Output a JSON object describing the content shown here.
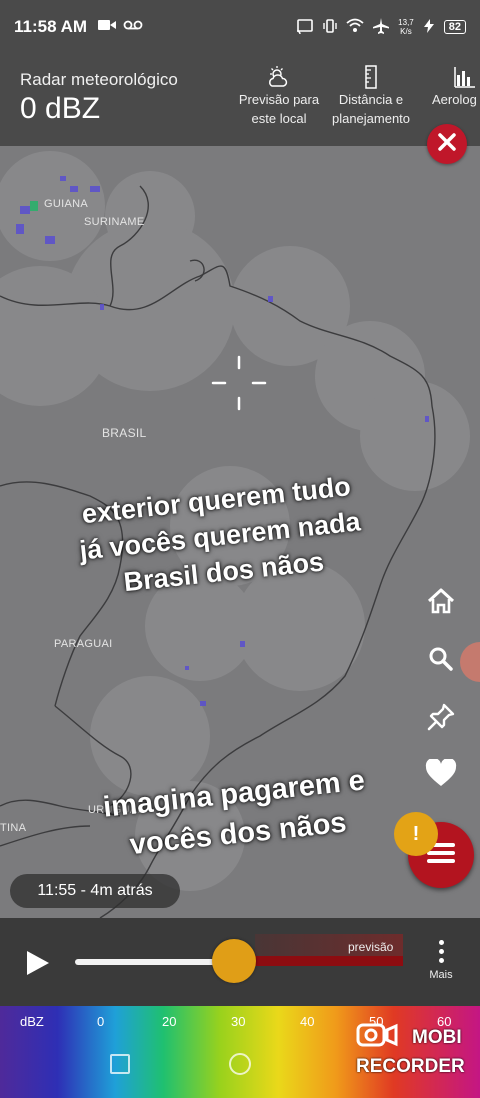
{
  "status": {
    "time": "11:58 AM",
    "net_speed_value": "13,7",
    "net_speed_unit": "K/s",
    "battery": "82"
  },
  "header": {
    "title": "Radar meteorológico",
    "value": "0 dBZ",
    "tools": [
      {
        "line1": "Previsão para",
        "line2": "este local",
        "icon": "sun-cloud-icon"
      },
      {
        "line1": "Distância e",
        "line2": "planejamento",
        "icon": "ruler-icon"
      },
      {
        "line1": "Aerolog",
        "line2": "",
        "icon": "bar-chart-icon"
      }
    ]
  },
  "map": {
    "labels": {
      "guiana": "GUIANA",
      "suriname": "SURINAME",
      "brasil": "BRASIL",
      "paraguai": "PARAGUAI",
      "uruguai": "URUGUAI",
      "argentina": "TINA"
    },
    "overlay_text_1": [
      "exterior querem tudo",
      "já vocês querem nada",
      "Brasil dos nãos"
    ],
    "overlay_text_2": [
      "imagina pagarem e",
      "vocês dos nãos"
    ],
    "time_chip": "11:55 - 4m atrás",
    "alert_badge": "!"
  },
  "timeline": {
    "forecast_label": "previsão",
    "more_label": "Mais",
    "progress": 0.48
  },
  "legend": {
    "unit": "dBZ",
    "ticks": [
      "0",
      "20",
      "30",
      "40",
      "50",
      "60"
    ]
  },
  "watermark": {
    "line1": "MOBI",
    "line2": "RECORDER"
  },
  "colors": {
    "accent_red": "#b3141f",
    "thumb": "#e09e17",
    "map_bg": "#7b7b7d",
    "header_bg": "#4a4a4a"
  }
}
